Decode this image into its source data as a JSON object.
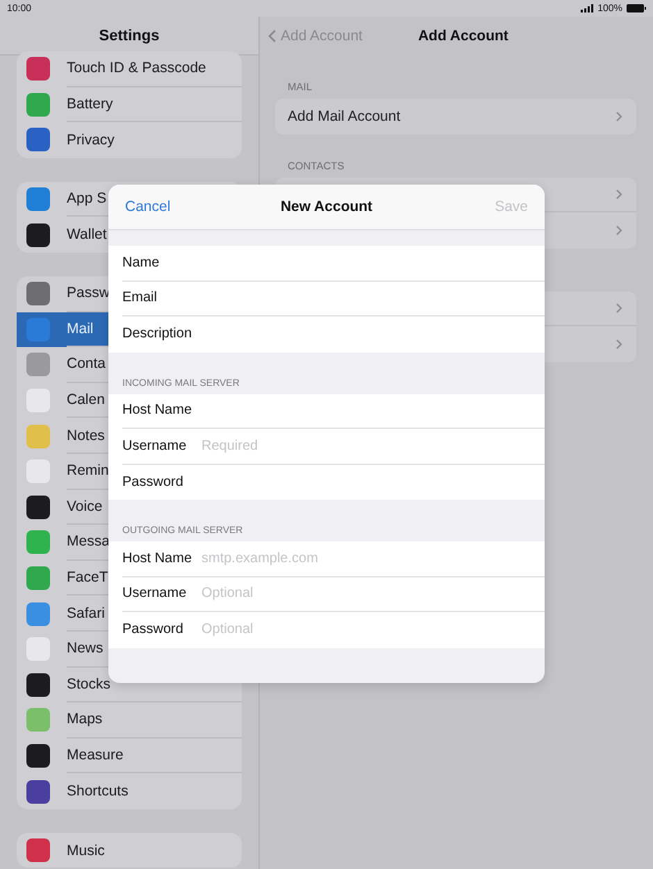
{
  "status_bar": {
    "time": "10:00",
    "battery": "100%"
  },
  "sidebar": {
    "title": "Settings",
    "groups": [
      [
        {
          "label": "Touch ID & Passcode",
          "color": "#c8305a",
          "selected": false
        },
        {
          "label": "Battery",
          "color": "#2fa84e",
          "selected": false
        },
        {
          "label": "Privacy",
          "color": "#2a62c4",
          "selected": false
        }
      ],
      [
        {
          "label": "App S",
          "color": "#1f7fd6",
          "selected": false
        },
        {
          "label": "Wallet",
          "color": "#1c1c1e",
          "selected": false
        }
      ],
      [
        {
          "label": "Passw",
          "color": "#6e6e72",
          "selected": false
        },
        {
          "label": "Mail",
          "color": "#2a7ad8",
          "selected": true
        },
        {
          "label": "Conta",
          "color": "#9a9a9e",
          "selected": false
        },
        {
          "label": "Calen",
          "color": "#e8e8ea",
          "selected": false
        },
        {
          "label": "Notes",
          "color": "#e0c04a",
          "selected": false
        },
        {
          "label": "Remin",
          "color": "#e8e8ea",
          "selected": false
        },
        {
          "label": "Voice",
          "color": "#1c1c1e",
          "selected": false
        },
        {
          "label": "Messa",
          "color": "#2fb34e",
          "selected": false
        },
        {
          "label": "FaceT",
          "color": "#2fa84e",
          "selected": false
        },
        {
          "label": "Safari",
          "color": "#3a8fe0",
          "selected": false
        },
        {
          "label": "News",
          "color": "#e8e8ea",
          "selected": false
        },
        {
          "label": "Stocks",
          "color": "#1c1c1e",
          "selected": false
        },
        {
          "label": "Maps",
          "color": "#7bbf6a",
          "selected": false
        },
        {
          "label": "Measure",
          "color": "#1c1c1e",
          "selected": false
        },
        {
          "label": "Shortcuts",
          "color": "#4a3f9e",
          "selected": false
        }
      ],
      [
        {
          "label": "Music",
          "color": "#d0304a",
          "selected": false
        }
      ]
    ]
  },
  "detail": {
    "back": "Add Account",
    "title": "Add Account",
    "sections": [
      {
        "header": "MAIL",
        "rows": [
          {
            "label": "Add Mail Account",
            "chevron": true
          }
        ]
      },
      {
        "header": "CONTACTS",
        "rows": [
          {
            "chevron": true
          },
          {
            "chevron": true
          }
        ]
      },
      {
        "rows": [
          {
            "chevron": true
          },
          {
            "chevron": true
          }
        ]
      }
    ]
  },
  "dialog": {
    "cancel": "Cancel",
    "title": "New Account",
    "save": {
      "label": "Save",
      "disabled": true
    },
    "sections": [
      {
        "rows": [
          {
            "label": "Name"
          },
          {
            "label": "Email"
          },
          {
            "label": "Description"
          }
        ]
      },
      {
        "header": "INCOMING MAIL SERVER",
        "rows": [
          {
            "label": "Host Name"
          },
          {
            "label": "Username",
            "placeholder": "Required"
          },
          {
            "label": "Password"
          }
        ]
      },
      {
        "header": "OUTGOING MAIL SERVER",
        "rows": [
          {
            "label": "Host Name",
            "placeholder": "smtp.example.com"
          },
          {
            "label": "Username",
            "placeholder": "Optional"
          },
          {
            "label": "Password",
            "placeholder": "Optional"
          }
        ]
      }
    ]
  }
}
